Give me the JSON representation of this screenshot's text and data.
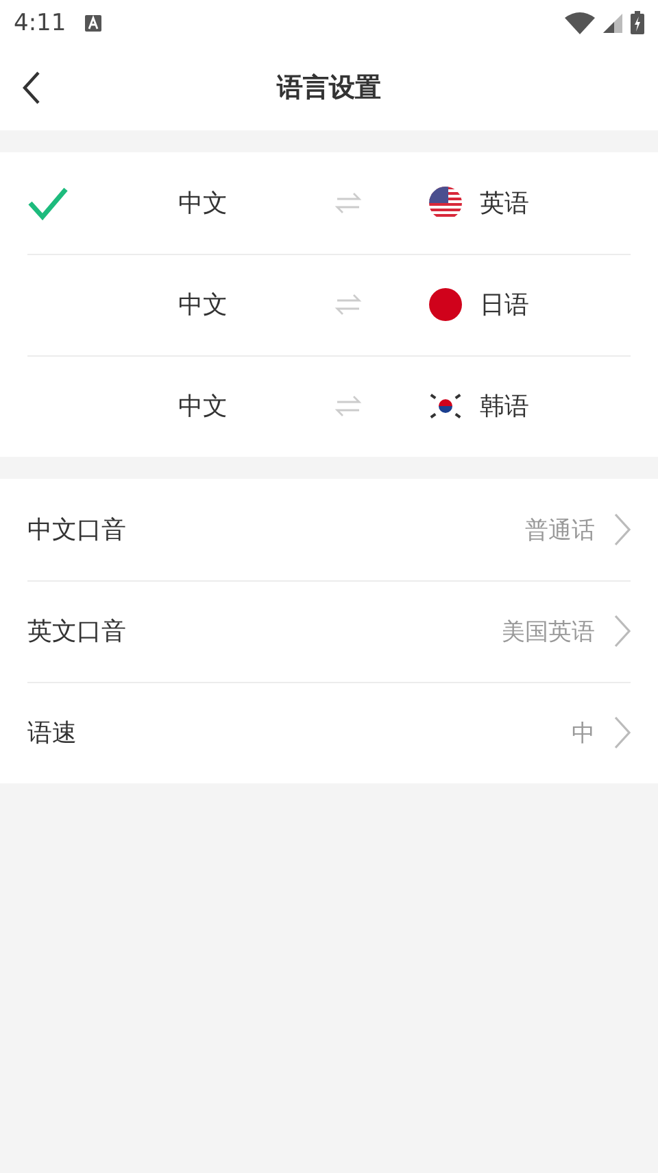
{
  "status_bar": {
    "time": "4:11"
  },
  "header": {
    "title": "语言设置"
  },
  "language_pairs": [
    {
      "source": "中文",
      "target": "英语",
      "kind": "us",
      "selected": true
    },
    {
      "source": "中文",
      "target": "日语",
      "kind": "jp",
      "selected": false
    },
    {
      "source": "中文",
      "target": "韩语",
      "kind": "kr",
      "selected": false
    }
  ],
  "settings": [
    {
      "label": "中文口音",
      "value": "普通话"
    },
    {
      "label": "英文口音",
      "value": "美国英语"
    },
    {
      "label": "语速",
      "value": "中"
    }
  ]
}
